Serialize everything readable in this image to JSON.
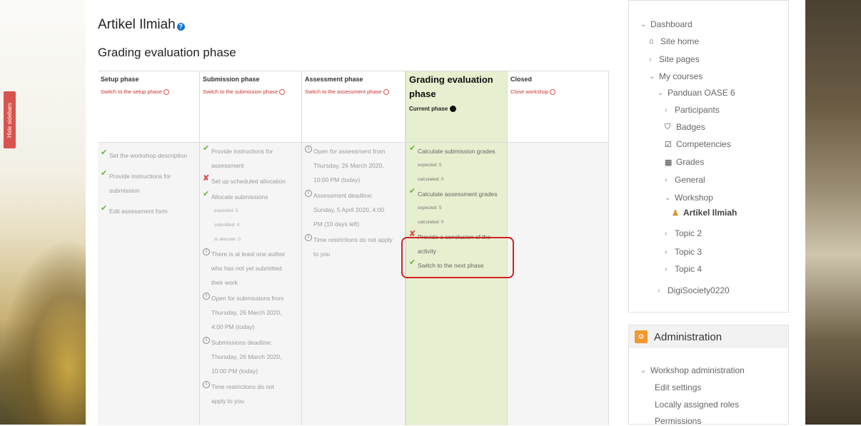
{
  "hide_sidebars": "Hide sidebars",
  "page": {
    "title": "Artikel Ilmiah",
    "phase_heading": "Grading evaluation phase"
  },
  "phases": [
    {
      "name": "Setup phase",
      "switch": "Switch to the setup phase",
      "tasks": [
        {
          "status": "done",
          "text": "Set the workshop description"
        },
        {
          "status": "done",
          "text": "Provide instructions for submission"
        },
        {
          "status": "done",
          "text": "Edit assessment form"
        }
      ]
    },
    {
      "name": "Submission phase",
      "switch": "Switch to the submission phase",
      "tasks": [
        {
          "status": "done",
          "text": "Provide instructions for assessment"
        },
        {
          "status": "fail",
          "text": "Set up scheduled allocation"
        },
        {
          "status": "done",
          "text": "Allocate submissions",
          "details": [
            "expected: 5",
            "submitted: 4",
            "to allocate: 0"
          ]
        },
        {
          "status": "info",
          "text": "There is at least one author who has not yet submitted their work"
        },
        {
          "status": "info",
          "text": "Open for submissions from Thursday, 26 March 2020, 4:00 PM (today)"
        },
        {
          "status": "info",
          "text": "Submissions deadline: Thursday, 26 March 2020, 10:00 PM (today)"
        },
        {
          "status": "info",
          "text": "Time restrictions do not apply to you"
        }
      ]
    },
    {
      "name": "Assessment phase",
      "switch": "Switch to the assessment phase",
      "tasks": [
        {
          "status": "info",
          "text": "Open for assessment from Thursday, 26 March 2020, 10:00 PM (today)"
        },
        {
          "status": "info",
          "text": "Assessment deadline: Sunday, 5 April 2020, 4:00 PM (10 days left)"
        },
        {
          "status": "info",
          "text": "Time restrictions do not apply to you"
        }
      ]
    },
    {
      "name": "Grading evaluation phase",
      "current_label": "Current phase",
      "tasks": [
        {
          "status": "done",
          "text": "Calculate submission grades",
          "details": [
            "expected: 5",
            "calculated: 0"
          ]
        },
        {
          "status": "done",
          "text": "Calculate assessment grades",
          "details": [
            "expected: 5",
            "calculated: 0"
          ]
        },
        {
          "status": "fail",
          "text": "Provide a conclusion of the activity"
        },
        {
          "status": "done",
          "text": "Switch to the next phase"
        }
      ]
    },
    {
      "name": "Closed",
      "switch": "Close workshop",
      "tasks": []
    }
  ],
  "navigation": {
    "items": [
      {
        "label": "Dashboard",
        "type": "expanded"
      },
      {
        "label": "Site home",
        "type": "icon",
        "icon": "home-icon"
      },
      {
        "label": "Site pages",
        "type": "collapsed"
      },
      {
        "label": "My courses",
        "type": "expanded"
      },
      {
        "label": "Panduan OASE 6",
        "type": "expanded"
      },
      {
        "label": "Participants",
        "type": "collapsed"
      },
      {
        "label": "Badges",
        "type": "icon",
        "icon": "shield-icon"
      },
      {
        "label": "Competencies",
        "type": "icon",
        "icon": "checkbox-icon"
      },
      {
        "label": "Grades",
        "type": "icon",
        "icon": "table-icon"
      },
      {
        "label": "General",
        "type": "collapsed"
      },
      {
        "label": "Workshop",
        "type": "expanded"
      },
      {
        "label": "Artikel Ilmiah",
        "type": "current",
        "icon": "workshop-icon"
      },
      {
        "label": "Topic 2",
        "type": "collapsed"
      },
      {
        "label": "Topic 3",
        "type": "collapsed"
      },
      {
        "label": "Topic 4",
        "type": "collapsed"
      },
      {
        "label": "DigiSociety0220",
        "type": "collapsed"
      }
    ]
  },
  "administration": {
    "title": "Administration",
    "items": [
      {
        "label": "Workshop administration",
        "type": "expanded"
      },
      {
        "label": "Edit settings",
        "type": "link"
      },
      {
        "label": "Locally assigned roles",
        "type": "link"
      },
      {
        "label": "Permissions",
        "type": "link"
      }
    ]
  }
}
